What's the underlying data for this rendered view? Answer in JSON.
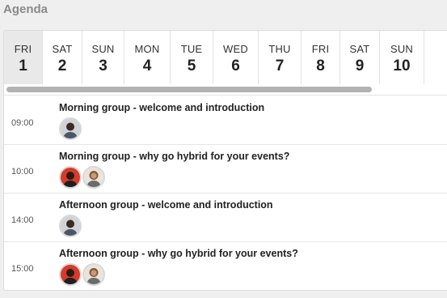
{
  "agenda": {
    "title": "Agenda"
  },
  "days": [
    {
      "name": "FRI",
      "number": "1"
    },
    {
      "name": "SAT",
      "number": "2"
    },
    {
      "name": "SUN",
      "number": "3"
    },
    {
      "name": "MON",
      "number": "4"
    },
    {
      "name": "TUE",
      "number": "5"
    },
    {
      "name": "WED",
      "number": "6"
    },
    {
      "name": "THU",
      "number": "7"
    },
    {
      "name": "FRI",
      "number": "8"
    },
    {
      "name": "SAT",
      "number": "9"
    },
    {
      "name": "SUN",
      "number": "10"
    }
  ],
  "selected_day": "FRI 1",
  "sessions": [
    {
      "time": "09:00",
      "title": "Morning group - welcome and introduction",
      "speakers": [
        "speaker-a-avatar"
      ]
    },
    {
      "time": "10:00",
      "title": "Morning group - why go hybrid for your events?",
      "speakers": [
        "speaker-b-avatar",
        "speaker-c-avatar"
      ]
    },
    {
      "time": "14:00",
      "title": "Afternoon group - welcome and introduction",
      "speakers": [
        "speaker-a-avatar"
      ]
    },
    {
      "time": "15:00",
      "title": "Afternoon group - why go hybrid for your events?",
      "speakers": [
        "speaker-b-avatar",
        "speaker-c-avatar"
      ]
    }
  ],
  "colors": {
    "selected_day_bg": "#e9e9e9",
    "scrollbar": "#b3b3b3",
    "heading": "#8a8a8a"
  }
}
